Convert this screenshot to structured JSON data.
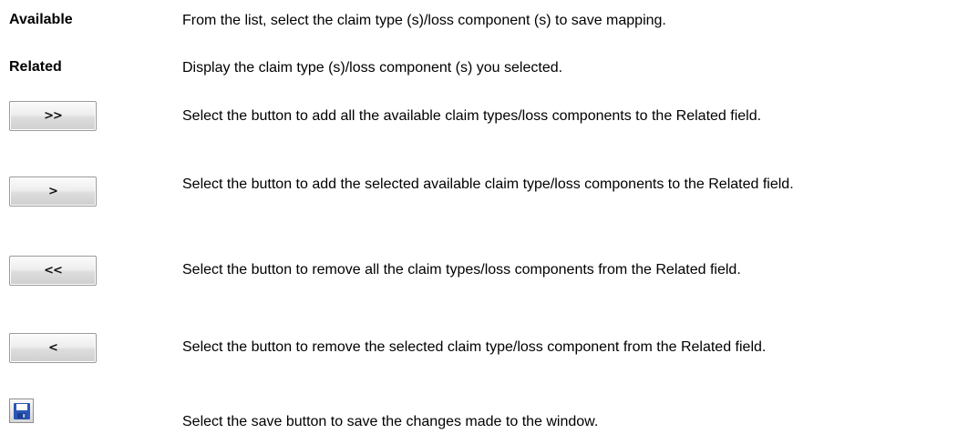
{
  "rows": [
    {
      "term": "Available",
      "description": "From the list, select the claim type (s)/loss component (s) to save mapping."
    },
    {
      "term": "Related",
      "description": "Display the claim type (s)/loss component (s) you selected."
    }
  ],
  "buttons": [
    {
      "label": ">>",
      "icon": "double-right-arrow-icon",
      "description": "Select the button to add all the available claim types/loss components to the Related field."
    },
    {
      "label": ">",
      "icon": "right-arrow-icon",
      "description": "Select the button to add the selected available claim type/loss components to the Related field."
    },
    {
      "label": "<<",
      "icon": "double-left-arrow-icon",
      "description": "Select the button to remove all the claim types/loss components from the Related field."
    },
    {
      "label": "<",
      "icon": "left-arrow-icon",
      "description": "Select the button to remove the selected claim type/loss component from the Related field."
    }
  ],
  "save": {
    "icon": "floppy-disk-icon",
    "description": "Select the save button to save the changes made to the window.",
    "colors": {
      "disk": "#2a56b8",
      "label": "#ffffff",
      "shutter": "#1c3f8f"
    }
  }
}
